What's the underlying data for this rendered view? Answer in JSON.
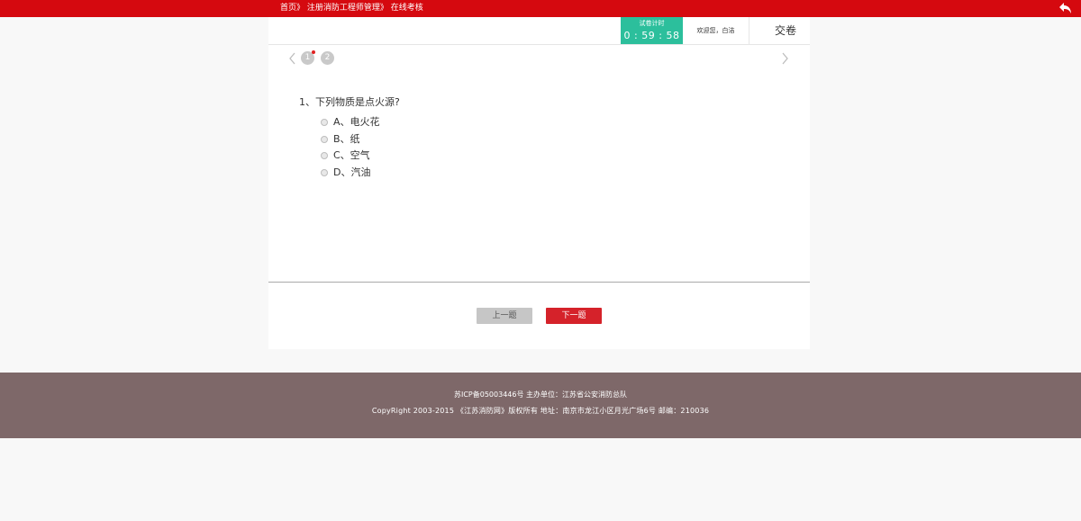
{
  "breadcrumb": {
    "items": [
      "首页》",
      "注册消防工程师管理》",
      "在线考核"
    ]
  },
  "header": {
    "timer_label": "试卷计时",
    "timer_value": "0 : 59 : 58",
    "welcome": "欢迎您，白洁",
    "submit_label": "交卷"
  },
  "question_nav": {
    "numbers": [
      "1",
      "2"
    ]
  },
  "question": {
    "text": "1、下列物质是点火源?",
    "options": [
      "A、电火花",
      "B、纸",
      "C、空气",
      "D、汽油"
    ]
  },
  "buttons": {
    "prev_label": "上一题",
    "next_label": "下一题"
  },
  "footer": {
    "line1": "苏ICP备05003446号 主办单位：江苏省公安消防总队",
    "line2": "CopyRight 2003-2015 《江苏消防网》版权所有 地址：南京市龙江小区月光广场6号 邮编：210036"
  },
  "colors": {
    "topbar": "#d5090f",
    "timer": "#2cbf9c",
    "next_button": "#d5222a",
    "footer": "#7e6869"
  },
  "icons": {
    "back": "undo-arrow-icon",
    "prev": "chevron-left-icon",
    "next": "chevron-right-icon"
  }
}
